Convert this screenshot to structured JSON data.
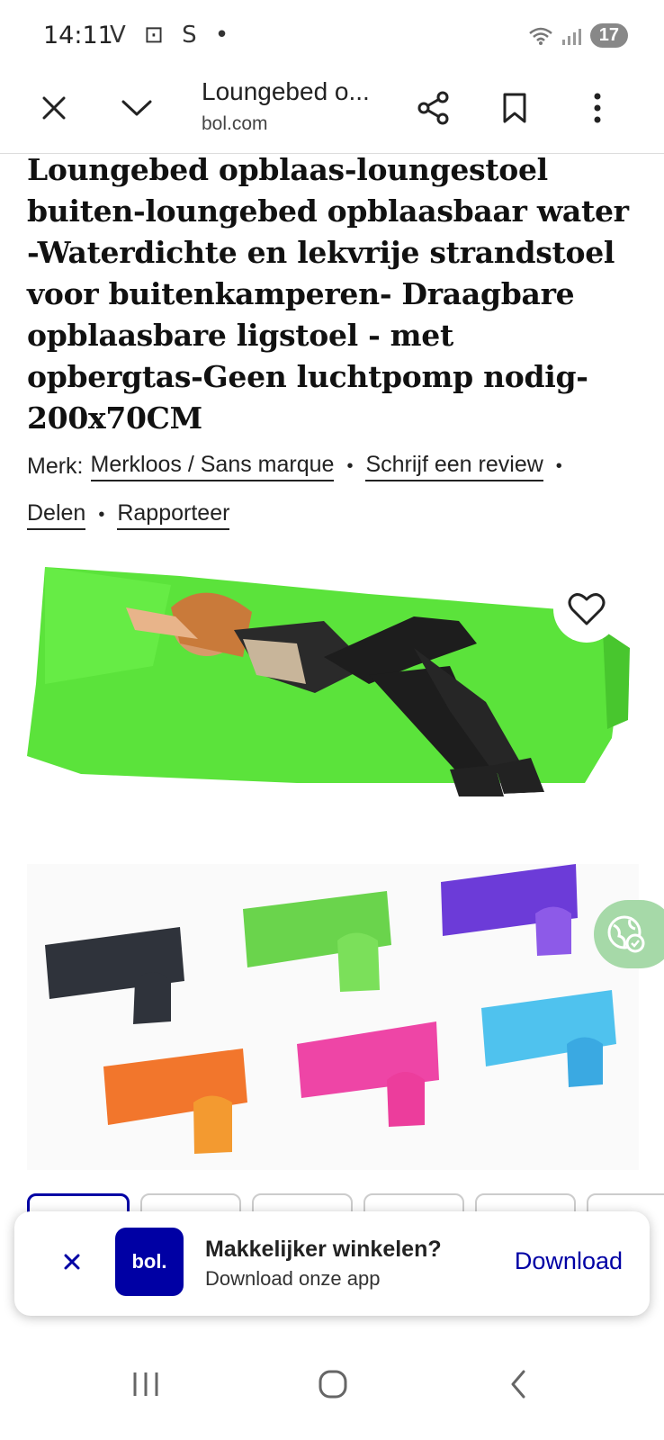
{
  "status_bar": {
    "time": "14:11",
    "notif_icons": "V ⊡ S •",
    "badge": "17"
  },
  "toolbar": {
    "page_title": "Loungebed o...",
    "domain": "bol.com"
  },
  "product": {
    "title": "Loungebed opblaas-loungestoel buiten-loungebed opblaasbaar water -Waterdichte en lekvrije strandstoel voor buitenkamperen- Draagbare opblaasbare ligstoel - met opbergtas-Geen luchtpomp nodig-200x70CM",
    "brand_label": "Merk:",
    "brand": "Merkloos / Sans marque",
    "review_link": "Schrijf een review",
    "share_link": "Delen",
    "report_link": "Rapporteer"
  },
  "app_banner": {
    "logo_text": "bol.",
    "title": "Makkelijker winkelen?",
    "subtitle": "Download onze app",
    "download": "Download"
  },
  "colors": {
    "brand_blue": "#0000a4",
    "lounger_green": "#55e63a"
  }
}
